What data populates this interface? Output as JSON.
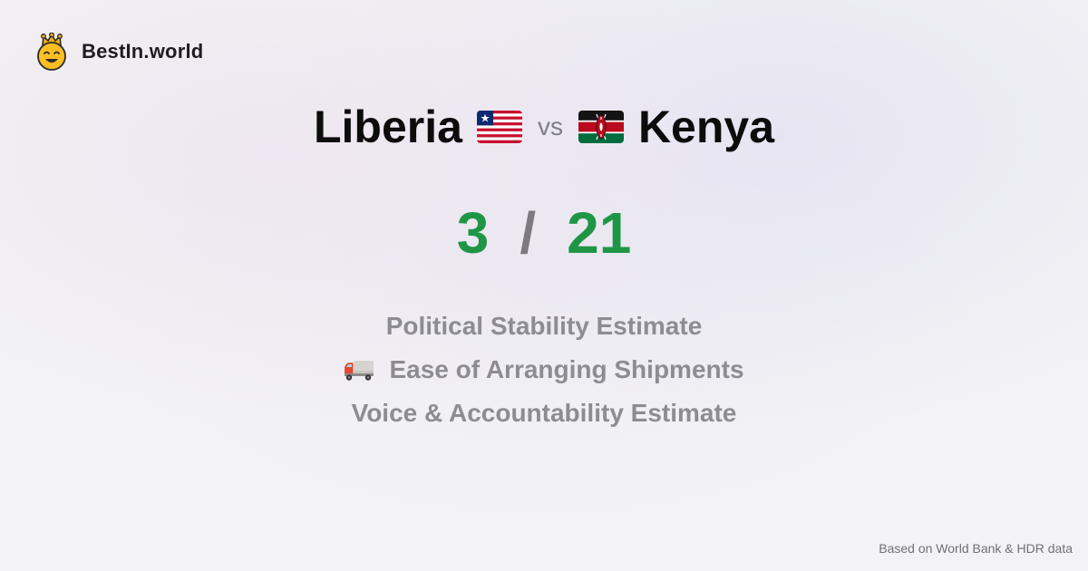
{
  "brand": {
    "name": "BestIn.world",
    "logo_icon": "crowned-smiley-icon"
  },
  "comparison": {
    "country_a": {
      "name": "Liberia",
      "flag_icon": "liberia-flag-icon"
    },
    "vs_label": "vs",
    "country_b": {
      "name": "Kenya",
      "flag_icon": "kenya-flag-icon"
    }
  },
  "score": {
    "a": "3",
    "separator": "/",
    "b": "21",
    "color": "#1f9645"
  },
  "criteria": [
    {
      "label": "Political Stability Estimate",
      "icon": ""
    },
    {
      "label": "Ease of Arranging Shipments",
      "icon": "delivery-truck-icon"
    },
    {
      "label": "Voice & Accountability Estimate",
      "icon": ""
    }
  ],
  "footer": {
    "source_note": "Based on World Bank & HDR data"
  },
  "colors": {
    "background": "#f3f3f5",
    "score_green": "#1f9645",
    "criteria_gray": "#8c8c92"
  }
}
